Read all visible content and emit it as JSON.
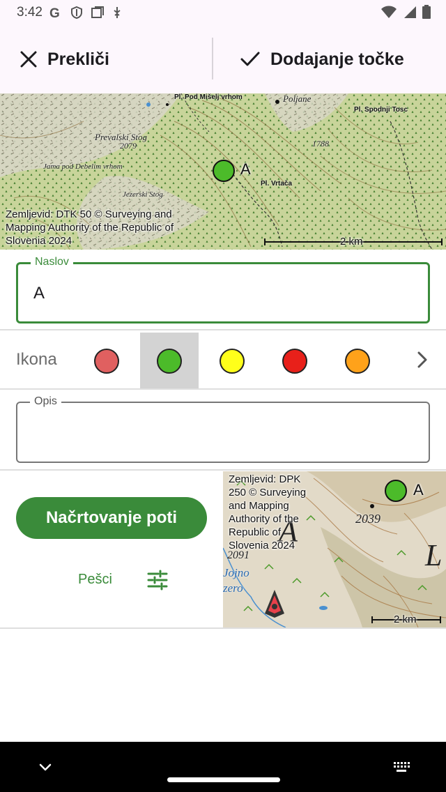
{
  "status_bar": {
    "time": "3:42",
    "icons_left": [
      "google-icon",
      "shield-icon",
      "screen-icon",
      "usb-icon"
    ],
    "icons_right": [
      "wifi-icon",
      "signal-icon",
      "battery-icon"
    ]
  },
  "action_bar": {
    "cancel_label": "Prekliči",
    "confirm_label": "Dodajanje točke"
  },
  "map_top": {
    "attribution": "Zemljevid: DTK 50 © Surveying and Mapping Authority of the Republic of Slovenia 2024",
    "marker_label": "A",
    "marker_color": "#4cbb2a",
    "scale_label": "2 km",
    "place_labels": {
      "pod_miselj": "Pl. Pod Mišelj vrhom",
      "poljane": "Poljane",
      "spodnji_tosc": "Pl. Spodnji Tosc",
      "prevalski_stog": "Prevalski Stog",
      "peak_2079": "2079",
      "peak_1788": "1788",
      "jama": "Jama pod Debelim vrhom",
      "vrtaca": "Pl. Vrtača",
      "jezerski_stog": "Jezerski Stog"
    }
  },
  "title_field": {
    "label": "Naslov",
    "value": "A"
  },
  "icon_picker": {
    "label": "Ikona",
    "colors": [
      "#e06060",
      "#4cbb2a",
      "#ffff1a",
      "#e8201a",
      "#ffa21a"
    ],
    "selected_index": 1
  },
  "description_field": {
    "label": "Opis",
    "value": ""
  },
  "routing": {
    "button_label": "Načrtovanje poti",
    "mode_label": "Pešci"
  },
  "map_bottom": {
    "attribution": "Zemljevid: DPK 250 © Surveying and Mapping Authority of the Republic of Slovenia 2024",
    "marker_label": "A",
    "scale_label": "2 km",
    "peak_2039": "2039",
    "peak_2091": "2091",
    "lake_label_1": "Jojno",
    "lake_label_2": "zero"
  },
  "colors": {
    "accent": "#3a8b3a",
    "surface": "#fdf7fd"
  }
}
